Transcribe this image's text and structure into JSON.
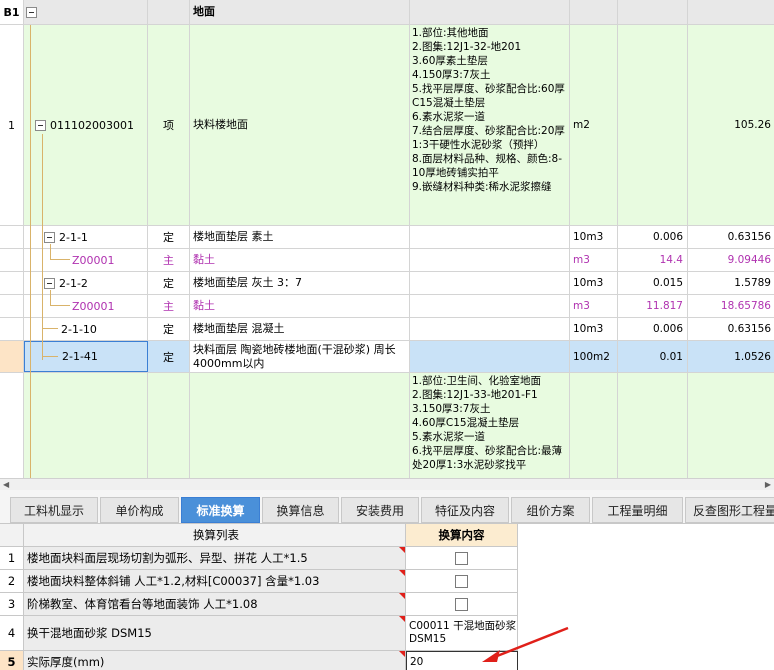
{
  "grid": {
    "header": {
      "rownum": "B1",
      "name": "地面"
    },
    "rows": [
      {
        "rownum": "1",
        "code": "011102003001",
        "type": "项",
        "name": "块料楼地面",
        "desc": [
          "1.部位:其他地面",
          "2.图集:12J1-32-地201",
          "3.60厚素土垫层",
          "4.150厚3:7灰土",
          "5.找平层厚度、砂浆配合比:60厚C15混凝土垫层",
          "6.素水泥浆一道",
          "7.结合层厚度、砂浆配合比:20厚1:3干硬性水泥砂浆（预拌）",
          "8.面层材料品种、规格、颜色:8-10厚地砖铺实拍平",
          "9.嵌缝材料种类:稀水泥浆擦缝"
        ],
        "unit": "m2",
        "qty_total": "105.26"
      },
      {
        "code": "2-1-1",
        "type": "定",
        "name": "楼地面垫层 素土",
        "unit": "10m3",
        "qty": "0.006",
        "qty_total": "0.63156"
      },
      {
        "code": "Z00001",
        "type": "主",
        "name": "黏土",
        "unit": "m3",
        "qty": "14.4",
        "qty_total": "9.09446"
      },
      {
        "code": "2-1-2",
        "type": "定",
        "name": "楼地面垫层 灰土 3：7",
        "unit": "10m3",
        "qty": "0.015",
        "qty_total": "1.5789"
      },
      {
        "code": "Z00001",
        "type": "主",
        "name": "黏土",
        "unit": "m3",
        "qty": "11.817",
        "qty_total": "18.65786"
      },
      {
        "code": "2-1-10",
        "type": "定",
        "name": "楼地面垫层 混凝土",
        "unit": "10m3",
        "qty": "0.006",
        "qty_total": "0.63156"
      },
      {
        "code": "2-1-41",
        "type": "定",
        "name": "块料面层 陶瓷地砖楼地面(干混砂浆) 周长4000mm以内",
        "unit": "100m2",
        "qty": "0.01",
        "qty_total": "1.0526"
      },
      {
        "desc": [
          "1.部位:卫生间、化验室地面",
          "2.图集:12J1-33-地201-F1",
          "3.150厚3:7灰土",
          "4.60厚C15混凝土垫层",
          "5.素水泥浆一道",
          "6.找平层厚度、砂浆配合比:最薄处20厚1:3水泥砂浆找平"
        ]
      }
    ]
  },
  "tabs": [
    "工料机显示",
    "单价构成",
    "标准换算",
    "换算信息",
    "安装费用",
    "特征及内容",
    "组价方案",
    "工程量明细",
    "反查图形工程量"
  ],
  "active_tab": "标准换算",
  "conversion": {
    "headers": {
      "list": "换算列表",
      "content": "换算内容"
    },
    "rows": [
      {
        "num": "1",
        "label": "楼地面块料面层现场切割为弧形、异型、拼花 人工*1.5",
        "checked": false
      },
      {
        "num": "2",
        "label": "楼地面块料整体斜铺 人工*1.2,材料[C00037] 含量*1.03",
        "checked": false
      },
      {
        "num": "3",
        "label": "阶梯教室、体育馆看台等地面装饰 人工*1.08",
        "checked": false
      },
      {
        "num": "4",
        "label": "换干混地面砂浆 DSM15",
        "content": "C00011  干混地面砂浆 DSM15"
      },
      {
        "num": "5",
        "label": "实际厚度(mm)",
        "content": "20"
      }
    ]
  },
  "colors": {
    "selected_tab": "#4a90d9",
    "row_green": "#e8fbe0",
    "selected_row": "#c9e2f7",
    "material_text": "#b032b0",
    "annotation_arrow": "#e0201a"
  }
}
